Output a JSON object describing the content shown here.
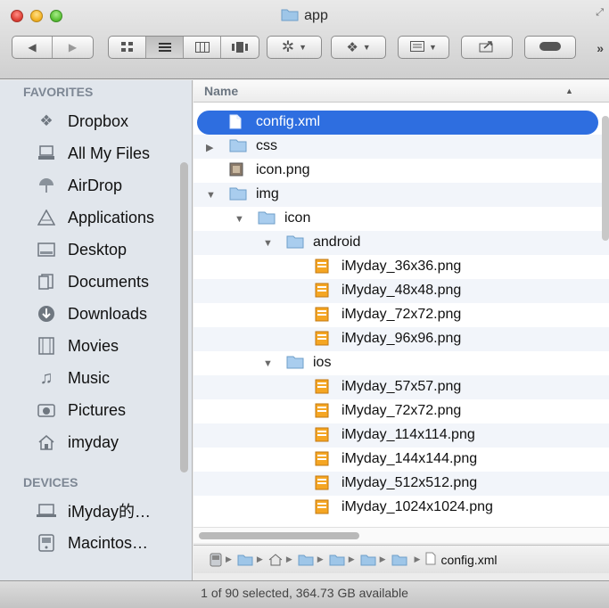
{
  "window": {
    "title": "app"
  },
  "toolbar": {
    "back_icon": "back-arrow-icon",
    "forward_icon": "forward-arrow-icon",
    "views": [
      "icon-view",
      "list-view",
      "column-view",
      "cover-flow-view"
    ],
    "action_icon": "gear-icon",
    "dropbox_icon": "dropbox-icon",
    "arrange_icon": "arrange-icon",
    "share_icon": "share-icon",
    "tags_icon": "tag-icon"
  },
  "sidebar": {
    "favorites_heading": "FAVORITES",
    "favorites": [
      {
        "label": "Dropbox",
        "icon": "dropbox-icon"
      },
      {
        "label": "All My Files",
        "icon": "all-files-icon"
      },
      {
        "label": "AirDrop",
        "icon": "airdrop-icon"
      },
      {
        "label": "Applications",
        "icon": "applications-icon"
      },
      {
        "label": "Desktop",
        "icon": "desktop-icon"
      },
      {
        "label": "Documents",
        "icon": "documents-icon"
      },
      {
        "label": "Downloads",
        "icon": "downloads-icon"
      },
      {
        "label": "Movies",
        "icon": "movies-icon"
      },
      {
        "label": "Music",
        "icon": "music-icon"
      },
      {
        "label": "Pictures",
        "icon": "pictures-icon"
      },
      {
        "label": "imyday",
        "icon": "home-icon"
      }
    ],
    "devices_heading": "DEVICES",
    "devices": [
      {
        "label": "iMyday的…",
        "icon": "laptop-icon"
      },
      {
        "label": "Macintos…",
        "icon": "disk-icon"
      }
    ]
  },
  "list": {
    "column_name": "Name",
    "rows": [
      {
        "name": "config.xml",
        "kind": "file",
        "level": 0,
        "selected": true
      },
      {
        "name": "css",
        "kind": "folder",
        "level": 0,
        "disclosure": "collapsed"
      },
      {
        "name": "icon.png",
        "kind": "image",
        "level": 0
      },
      {
        "name": "img",
        "kind": "folder",
        "level": 0,
        "disclosure": "expanded"
      },
      {
        "name": "icon",
        "kind": "folder",
        "level": 1,
        "disclosure": "expanded"
      },
      {
        "name": "android",
        "kind": "folder",
        "level": 2,
        "disclosure": "expanded"
      },
      {
        "name": "iMyday_36x36.png",
        "kind": "png",
        "level": 3
      },
      {
        "name": "iMyday_48x48.png",
        "kind": "png",
        "level": 3
      },
      {
        "name": "iMyday_72x72.png",
        "kind": "png",
        "level": 3
      },
      {
        "name": "iMyday_96x96.png",
        "kind": "png",
        "level": 3
      },
      {
        "name": "ios",
        "kind": "folder",
        "level": 2,
        "disclosure": "expanded"
      },
      {
        "name": "iMyday_57x57.png",
        "kind": "png",
        "level": 3
      },
      {
        "name": "iMyday_72x72.png",
        "kind": "png",
        "level": 3
      },
      {
        "name": "iMyday_114x114.png",
        "kind": "png",
        "level": 3
      },
      {
        "name": "iMyday_144x144.png",
        "kind": "png",
        "level": 3
      },
      {
        "name": "iMyday_512x512.png",
        "kind": "png",
        "level": 3
      },
      {
        "name": "iMyday_1024x1024.png",
        "kind": "png",
        "level": 3
      }
    ]
  },
  "pathbar": {
    "file_label": "config.xml"
  },
  "status": {
    "text": "1 of 90 selected, 364.73 GB available"
  },
  "colors": {
    "selection": "#2e6ee0",
    "folder": "#9ec6e8",
    "sidebar_bg": "#e1e6ec"
  }
}
